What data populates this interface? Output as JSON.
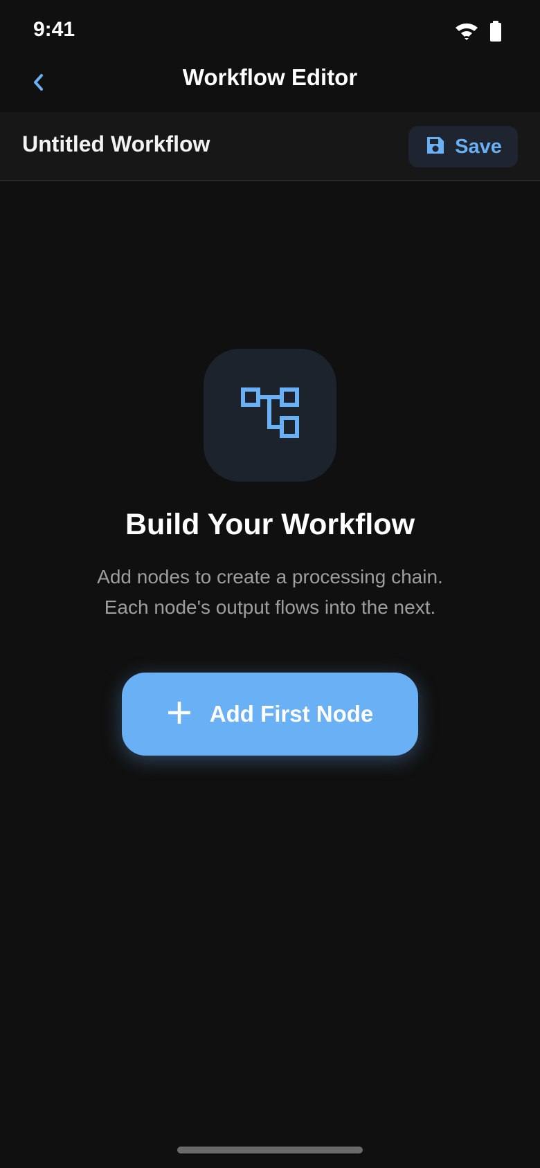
{
  "status_bar": {
    "time": "9:41",
    "icons": [
      "wifi-icon",
      "battery-icon"
    ]
  },
  "app_bar": {
    "title": "Workflow Editor",
    "back_icon": "chevron-left-icon"
  },
  "workflow": {
    "name": "Untitled Workflow",
    "save_label": "Save",
    "save_icon": "floppy-disk-icon"
  },
  "empty_state": {
    "icon": "workflow-tree-icon",
    "title": "Build Your Workflow",
    "description_line1": "Add nodes to create a processing chain.",
    "description_line2": "Each node's output flows into the next.",
    "button_label": "Add First Node",
    "button_icon": "plus-icon"
  },
  "colors": {
    "background": "#101010",
    "header_background": "#171717",
    "accent": "#6ab0f5",
    "icon_box": "#1c232d",
    "muted_text": "#9e9e9e"
  }
}
